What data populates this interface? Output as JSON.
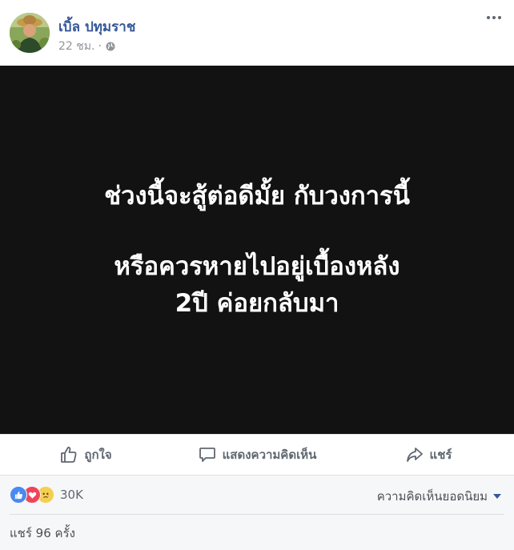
{
  "post": {
    "author": "เบิ้ล ปทุมราช",
    "time": "22 ชม.",
    "separator": "·",
    "privacy_icon": "globe-icon"
  },
  "status": {
    "line1": "ช่วงนี้จะสู้ต่อดีมั้ย กับวงการนี้",
    "line2": "หรือควรหายไปอยู่เบื้องหลัง",
    "line3": "2ปี ค่อยกลับมา",
    "background_color": "#121212",
    "text_color": "#ffffff"
  },
  "actions": {
    "like": "ถูกใจ",
    "comment": "แสดงความคิดเห็น",
    "share": "แชร์"
  },
  "footer": {
    "reaction_icons": [
      "like-icon",
      "love-icon",
      "sad-icon"
    ],
    "reaction_count": "30K",
    "sort_label": "ความคิดเห็นยอดนิยม",
    "share_count": "แชร์ 96 ครั้ง"
  },
  "colors": {
    "link": "#365899",
    "muted": "#90949c"
  }
}
